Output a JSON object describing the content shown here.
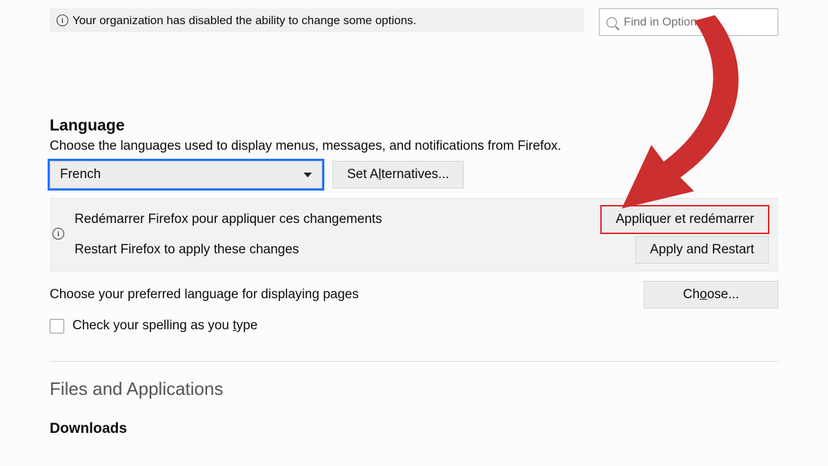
{
  "topbar": {
    "org_notice": "Your organization has disabled the ability to change some options.",
    "search_placeholder": "Find in Options"
  },
  "language": {
    "heading": "Language",
    "description": "Choose the languages used to display menus, messages, and notifications from Firefox.",
    "select_value": "French",
    "set_alternatives_label": "Set Alternatives...",
    "restart_fr": "Redémarrer Firefox pour appliquer ces changements",
    "apply_fr": "Appliquer et redémarrer",
    "restart_en": "Restart Firefox to apply these changes",
    "apply_en": "Apply and Restart",
    "preferred_pages": "Choose your preferred language for displaying pages",
    "choose_label": "Choose...",
    "spellcheck_label": "Check your spelling as you type"
  },
  "files_section": {
    "heading": "Files and Applications",
    "downloads_heading": "Downloads"
  },
  "annotation": {
    "arrow_color": "#cb2f2f"
  }
}
